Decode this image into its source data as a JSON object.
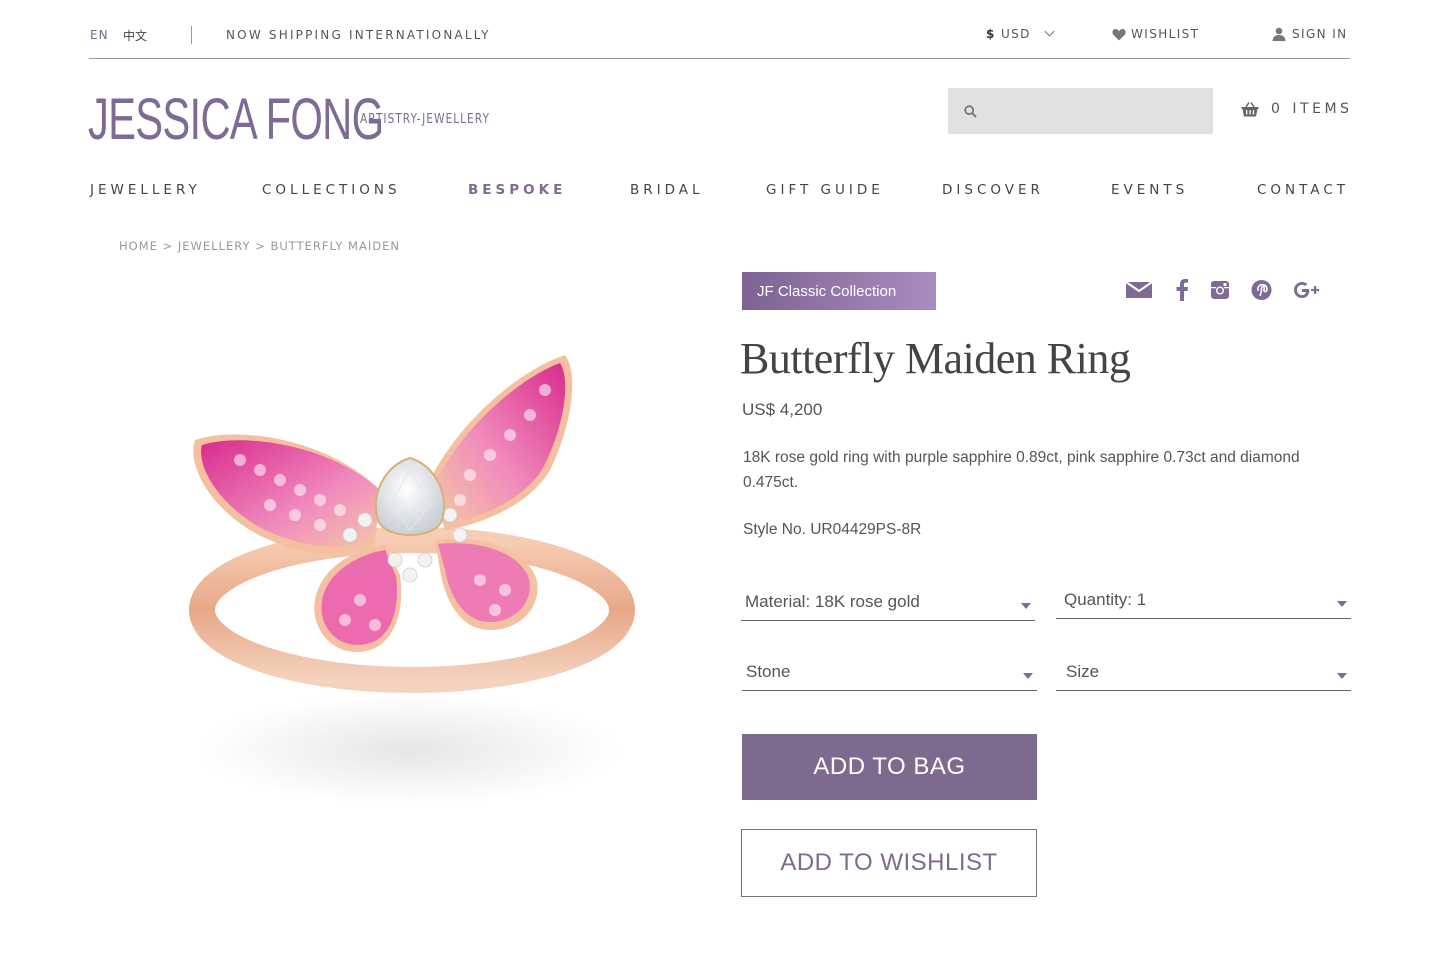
{
  "topbar": {
    "lang_en": "EN",
    "lang_zh": "中文",
    "shipping": "NOW SHIPPING INTERNATIONALLY",
    "currency_symbol": "$",
    "currency": "USD",
    "wishlist": "WISHLIST",
    "signin": "SIGN IN"
  },
  "header": {
    "logo": "JESSICA FONG",
    "tagline": "ARTISTRY-JEWELLERY",
    "search_placeholder": "",
    "cart_count": "0",
    "cart_label": "ITEMS"
  },
  "nav": {
    "items": [
      "JEWELLERY",
      "COLLECTIONS",
      "BESPOKE",
      "BRIDAL",
      "GIFT GUIDE",
      "DISCOVER",
      "EVENTS",
      "CONTACT"
    ],
    "active": "BESPOKE"
  },
  "breadcrumb": {
    "home": "HOME",
    "sep1": ">",
    "jewellery": "JEWELLERY",
    "sep2": ">",
    "current": "BUTTERFLY MAIDEN"
  },
  "product": {
    "collection_badge": "JF Classic Collection",
    "title": "Butterfly Maiden Ring",
    "price": "US$ 4,200",
    "description": "18K rose gold ring with purple sapphire 0.89ct, pink sapphire 0.73ct and diamond 0.475ct.",
    "style_no": "Style No. UR04429PS-8R",
    "material": "Material: 18K rose gold",
    "quantity": "Quantity: 1",
    "stone": "Stone",
    "size": "Size",
    "add_to_bag": "ADD TO BAG",
    "add_to_wishlist": "ADD TO WISHLIST"
  },
  "social_icons": [
    "mail-icon",
    "facebook-icon",
    "instagram-icon",
    "pinterest-icon",
    "google-plus-icon"
  ],
  "colors": {
    "brand": "#7f6a94",
    "button": "#7f6a8f",
    "search_bg": "#e1e1df"
  }
}
